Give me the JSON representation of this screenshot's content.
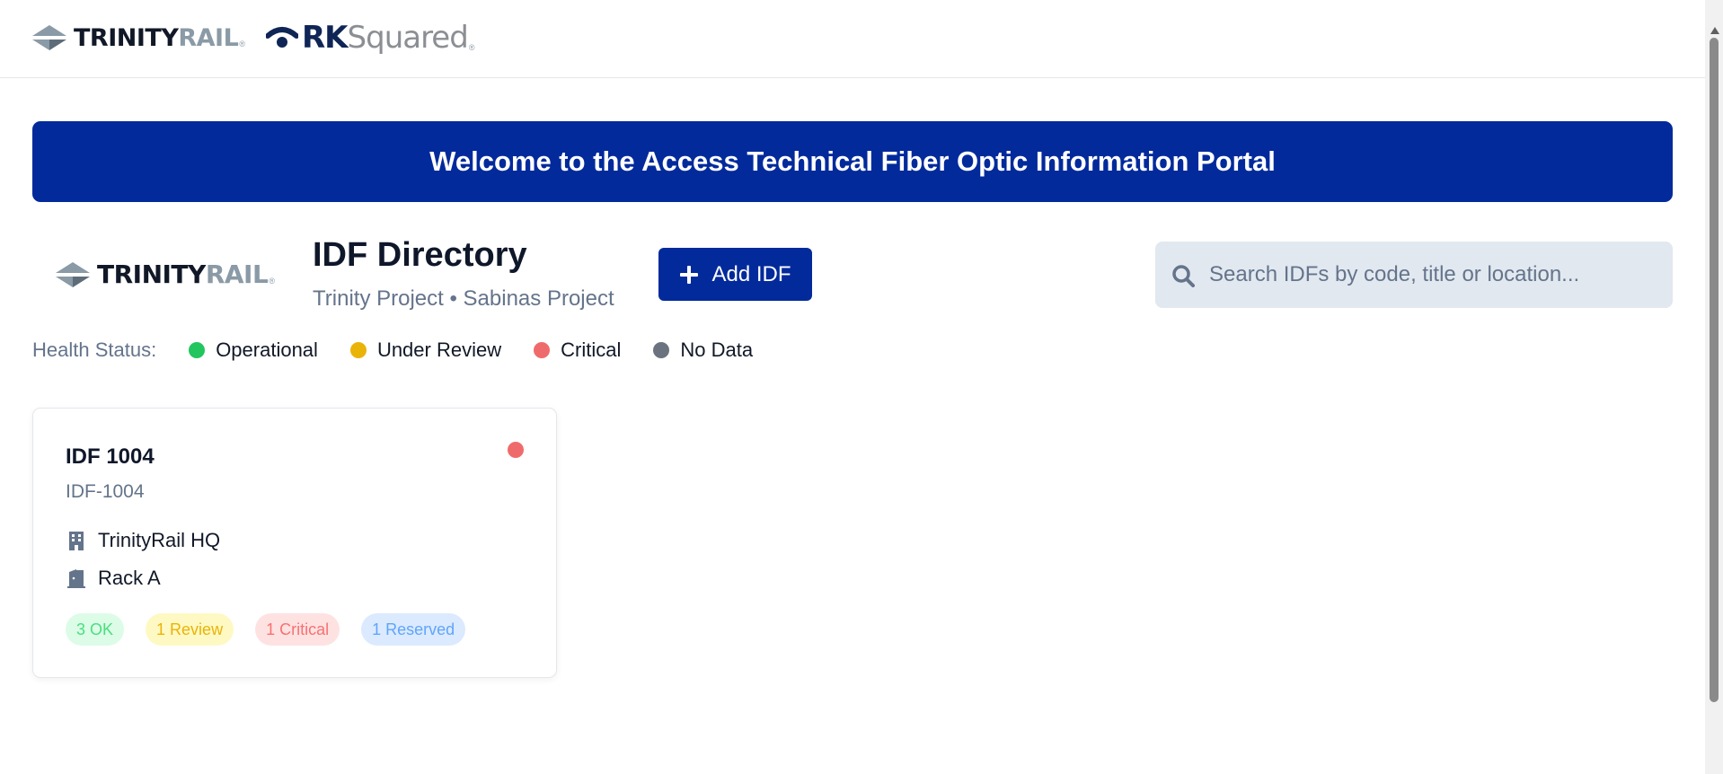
{
  "header": {
    "trinity_logo": {
      "word_a": "TRINITY",
      "word_b": "RAIL",
      "reg": "®"
    },
    "rk_logo": {
      "word_a": "RK",
      "word_b": "Squared",
      "reg": "®"
    }
  },
  "banner": {
    "text": "Welcome to the Access Technical Fiber Optic Information Portal"
  },
  "directory": {
    "logo": {
      "word_a": "TRINITY",
      "word_b": "RAIL",
      "reg": "®"
    },
    "title": "IDF Directory",
    "subtitle": "Trinity Project • Sabinas Project",
    "add_button_label": "Add IDF",
    "add_button_icon": "plus-icon"
  },
  "search": {
    "placeholder": "Search IDFs by code, title or location...",
    "value": "",
    "icon": "search-icon"
  },
  "legend": {
    "label": "Health Status:",
    "items": [
      {
        "label": "Operational",
        "color": "#22c55e"
      },
      {
        "label": "Under Review",
        "color": "#eab308"
      },
      {
        "label": "Critical",
        "color": "#ef6b6b"
      },
      {
        "label": "No Data",
        "color": "#6b7280"
      }
    ]
  },
  "cards": [
    {
      "title": "IDF 1004",
      "code": "IDF-1004",
      "status_color": "#ef6b6b",
      "building": "TrinityRail HQ",
      "building_icon": "building-icon",
      "rack": "Rack A",
      "rack_icon": "door-icon",
      "badges": [
        {
          "label": "3 OK",
          "bg": "#dcfce7",
          "fg": "#4ade80"
        },
        {
          "label": "1 Review",
          "bg": "#fef9c3",
          "fg": "#eab308"
        },
        {
          "label": "1 Critical",
          "bg": "#fee2e2",
          "fg": "#f87171"
        },
        {
          "label": "1 Reserved",
          "bg": "#dbeafe",
          "fg": "#60a5fa"
        }
      ]
    }
  ]
}
